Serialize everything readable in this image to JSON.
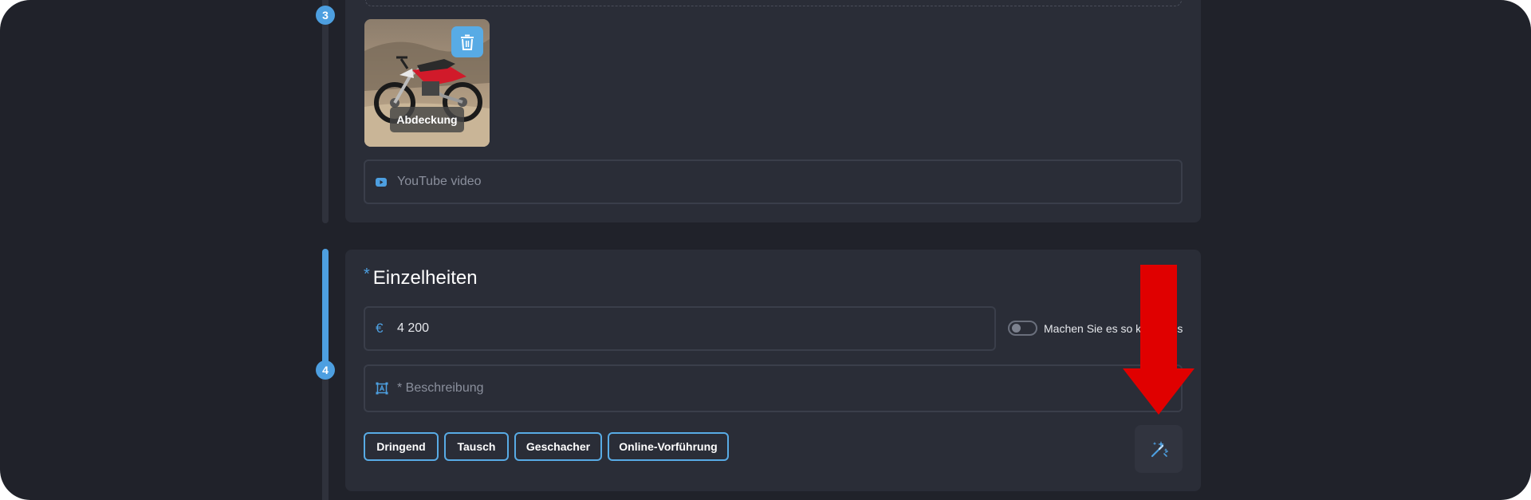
{
  "colors": {
    "accent": "#4d9fe0",
    "background": "#20222a",
    "card": "#2a2d37",
    "annotation_arrow": "#e00000"
  },
  "steps": {
    "photos_step": "3",
    "details_step": "4"
  },
  "media": {
    "cover_label": "Abdeckung",
    "delete_icon": "trash-icon",
    "youtube_placeholder": "YouTube video",
    "youtube_icon": "youtube-icon"
  },
  "details": {
    "required_marker": "*",
    "title": "Einzelheiten",
    "price_currency": "€",
    "price_value": "4 200",
    "free_toggle_label": "Machen Sie es so kostenlos",
    "free_toggle_on": false,
    "description_placeholder": "* Beschreibung",
    "description_icon": "translate-icon",
    "tags": [
      "Dringend",
      "Tausch",
      "Geschacher",
      "Online-Vorführung"
    ],
    "magic_button_icon": "magic-wand-icon"
  }
}
